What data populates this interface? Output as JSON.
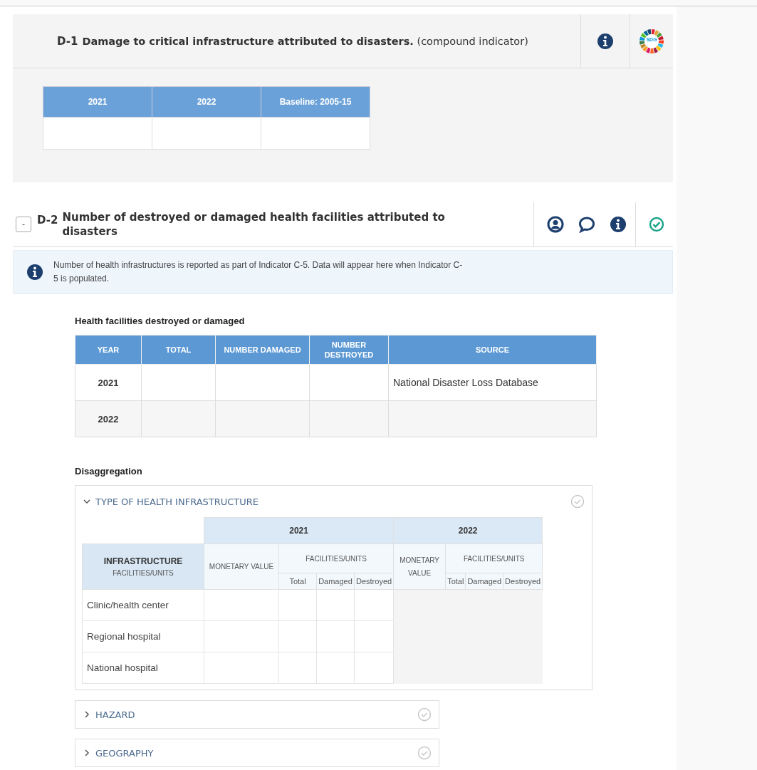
{
  "indicators": [
    {
      "code": "D-1",
      "title": "**Damage to critical infrastructure attributed to disasters.** (compound indicator)",
      "tools": [
        {
          "kind": "info"
        },
        {
          "kind": "sdg",
          "label": "SDG"
        }
      ],
      "table": {
        "headers": [
          "2021",
          "2022",
          "Baseline: 2005-15"
        ]
      }
    },
    {
      "code": "D-2",
      "toggle": "-",
      "title": "Number of destroyed or damaged health facilities attributed to disasters",
      "tools": [
        {
          "kind": "person"
        },
        {
          "kind": "comment"
        },
        {
          "kind": "info"
        },
        {
          "kind": "check"
        }
      ],
      "notice": "Number of health infrastructures is reported as part of Indicator C-5. Data will appear here when Indicator C-5 is populated.",
      "table_title": "Health facilities destroyed or damaged",
      "table": {
        "headers": [
          "YEAR",
          "TOTAL",
          "NUMBER DAMAGED",
          "NUMBER DESTROYED",
          "SOURCE"
        ],
        "rows": [
          {
            "year": "2021",
            "source": "National Disaster Loss Database"
          },
          {
            "year": "2022"
          }
        ]
      },
      "disaggregation": {
        "title": "Disaggregation",
        "sections": [
          {
            "title": "TYPE OF HEALTH INFRASTRUCTURE",
            "expanded": true,
            "table": {
              "corner_title": "INFRASTRUCTURE",
              "corner_subtitle": "FACILITIES/UNITS",
              "years": [
                {
                  "year": "2021",
                  "monetary": "MONETARY VALUE",
                  "group": "FACILITIES/UNITS",
                  "subcolumns": [
                    "Total",
                    "Damaged",
                    "Destroyed"
                  ],
                  "editable": true
                },
                {
                  "year": "2022",
                  "monetary": "MONETARY VALUE",
                  "group": "FACILITIES/UNITS",
                  "subcolumns": [
                    "Total",
                    "Damaged",
                    "Destroyed"
                  ],
                  "editable": false
                }
              ],
              "rows": [
                "Clinic/health center",
                "Regional hospital",
                "National hospital"
              ]
            }
          },
          {
            "title": "HAZARD",
            "expanded": false
          },
          {
            "title": "GEOGRAPHY",
            "expanded": false
          }
        ]
      }
    }
  ]
}
